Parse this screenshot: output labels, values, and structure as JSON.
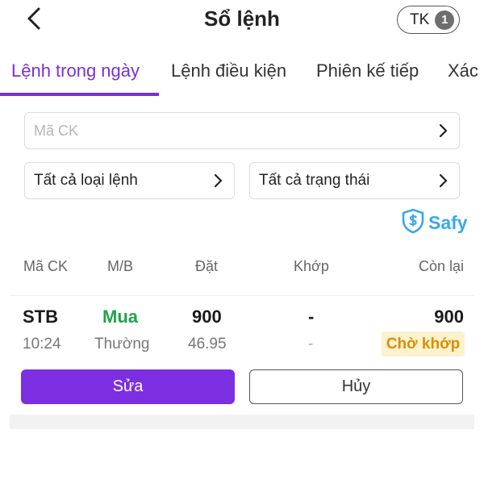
{
  "header": {
    "title": "Sổ lệnh",
    "account_label": "TK",
    "account_count": "1"
  },
  "tabs": [
    {
      "label": "Lệnh trong ngày",
      "active": true
    },
    {
      "label": "Lệnh điều kiện",
      "active": false
    },
    {
      "label": "Phiên kế tiếp",
      "active": false
    },
    {
      "label": "Xác n",
      "active": false
    }
  ],
  "filters": {
    "symbol_placeholder": "Mã CK",
    "order_type": "Tất cả loại lệnh",
    "status": "Tất cả trạng thái"
  },
  "brand": {
    "name": "Safy",
    "color": "#3aa8e8"
  },
  "table": {
    "columns": [
      "Mã CK",
      "M/B",
      "Đặt",
      "Khớp",
      "Còn lại"
    ]
  },
  "orders": [
    {
      "symbol": "STB",
      "side": "Mua",
      "quantity": "900",
      "matched": "-",
      "remaining": "900",
      "time": "10:24",
      "order_type": "Thường",
      "price": "46.95",
      "matched_price": "-",
      "status": "Chờ khớp",
      "edit_label": "Sửa",
      "cancel_label": "Hủy"
    }
  ],
  "colors": {
    "accent": "#7b2fd6",
    "buy": "#1fa34a",
    "pending_text": "#d98f00",
    "pending_bg": "#fdf2cf"
  }
}
